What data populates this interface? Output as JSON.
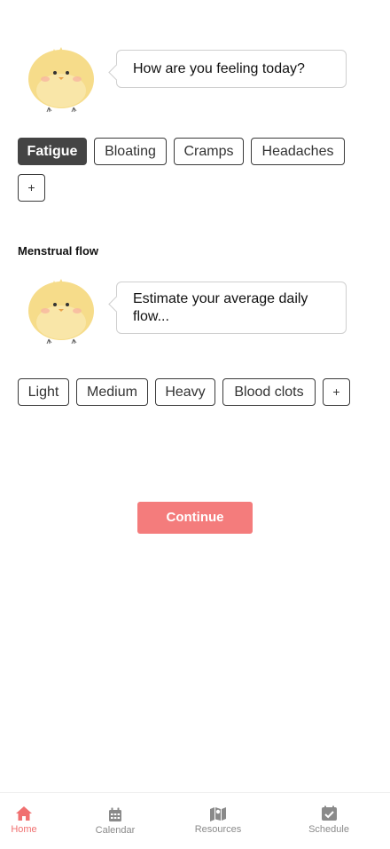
{
  "feeling": {
    "question": "How are you feeling today?",
    "chips": [
      {
        "label": "Fatigue",
        "selected": true
      },
      {
        "label": "Bloating",
        "selected": false
      },
      {
        "label": "Cramps",
        "selected": false
      },
      {
        "label": "Headaches",
        "selected": false
      }
    ],
    "add_label": "+"
  },
  "flow": {
    "section_label": "Menstrual flow",
    "question": "Estimate your average daily flow...",
    "chips": [
      {
        "label": "Light",
        "selected": false
      },
      {
        "label": "Medium",
        "selected": false
      },
      {
        "label": "Heavy",
        "selected": false
      },
      {
        "label": "Blood clots",
        "selected": false
      }
    ],
    "add_label": "+"
  },
  "continue_label": "Continue",
  "bottom_nav": {
    "items": [
      {
        "label": "Home",
        "icon": "home-icon",
        "active": true
      },
      {
        "label": "Calendar",
        "icon": "calendar-icon",
        "active": false
      },
      {
        "label": "Resources",
        "icon": "map-icon",
        "active": false
      },
      {
        "label": "Schedule",
        "icon": "checkbox-icon",
        "active": false
      }
    ]
  },
  "colors": {
    "accent": "#f47c7c",
    "selected_chip": "#444444",
    "active_nav": "#f07070",
    "chick_body": "#f6dc8a"
  }
}
